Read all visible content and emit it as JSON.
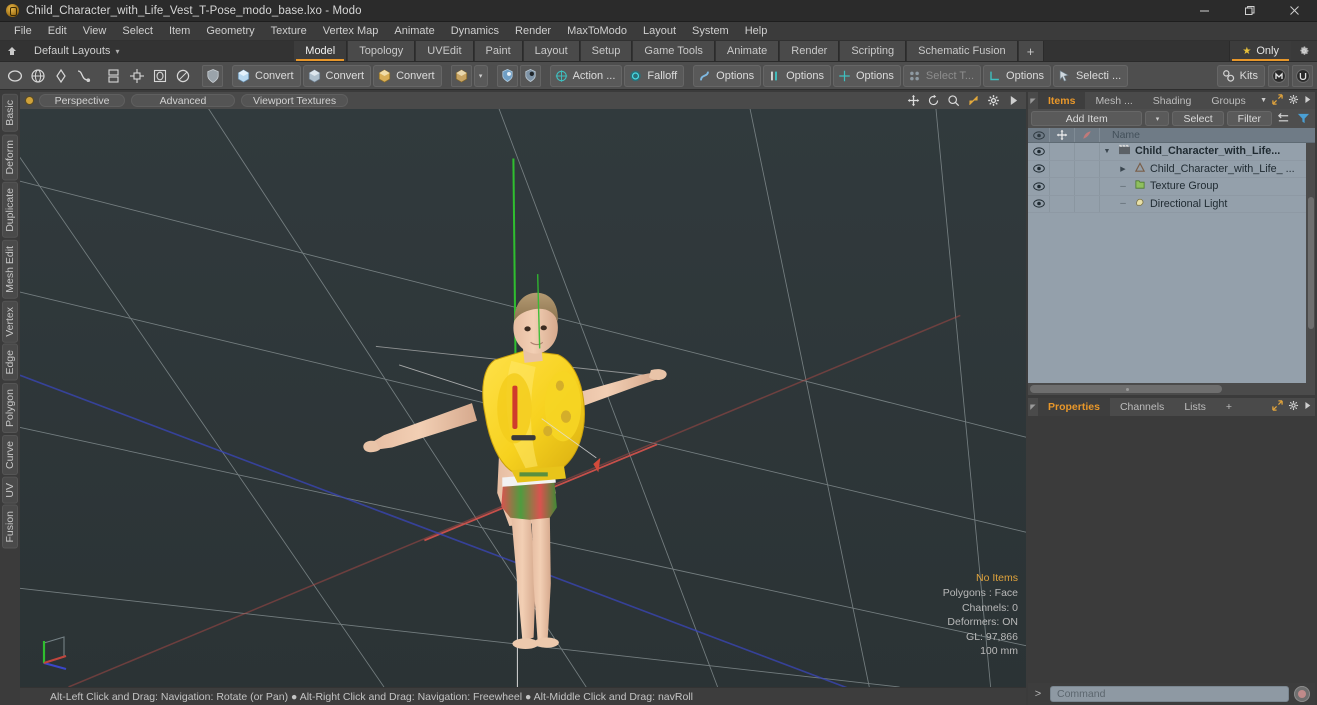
{
  "window": {
    "title": "Child_Character_with_Life_Vest_T-Pose_modo_base.lxo - Modo",
    "app_icon": "modo-icon",
    "minimize": "minimize-icon",
    "maximize": "restore-icon",
    "close": "close-icon"
  },
  "menubar": {
    "items": [
      "File",
      "Edit",
      "View",
      "Select",
      "Item",
      "Geometry",
      "Texture",
      "Vertex Map",
      "Animate",
      "Dynamics",
      "Render",
      "MaxToModo",
      "Layout",
      "System",
      "Help"
    ]
  },
  "layoutbar": {
    "home_icon": "home-icon",
    "default_layouts": "Default Layouts",
    "caret": "▾",
    "tabs": [
      {
        "label": "Model",
        "active": true
      },
      {
        "label": "Topology",
        "active": false
      },
      {
        "label": "UVEdit",
        "active": false
      },
      {
        "label": "Paint",
        "active": false
      },
      {
        "label": "Layout",
        "active": false
      },
      {
        "label": "Setup",
        "active": false
      },
      {
        "label": "Game Tools",
        "active": false
      },
      {
        "label": "Animate",
        "active": false
      },
      {
        "label": "Render",
        "active": false
      },
      {
        "label": "Scripting",
        "active": false
      },
      {
        "label": "Schematic Fusion",
        "active": false
      }
    ],
    "add_tab": "+",
    "only_label": "Only",
    "star_icon": "star-icon",
    "gear_icon": "gear-icon"
  },
  "toolbar": {
    "mode_icons": [
      "ellipse-icon",
      "globe-icon",
      "pen-icon",
      "curve-icon",
      "duplicate-icon",
      "crosshair-icon",
      "square-in-square-icon",
      "circle-slash-icon",
      "shield-icon"
    ],
    "buttons": [
      {
        "label": "Convert",
        "color": "#d9e8f2",
        "dim": false
      },
      {
        "label": "Convert",
        "color": "#cdd8e0",
        "dim": false
      },
      {
        "label": "Convert",
        "color": "#e3c884",
        "dim": false
      }
    ],
    "cube_icon": "cube-icon",
    "cube_caret": "▾",
    "paint_icons": [
      "falloff-blue-icon",
      "falloff-dark-icon"
    ],
    "action_button": {
      "label": "Action  ...",
      "icon": "action-center-icon"
    },
    "falloff_button": {
      "label": "Falloff",
      "icon": "falloff-icon"
    },
    "options_buttons": [
      {
        "label": "Options",
        "icon": "snap-icon"
      },
      {
        "label": "Options",
        "icon": "bars-icon"
      },
      {
        "label": "Options",
        "icon": "crosshair-icon"
      }
    ],
    "select_through": {
      "label": "Select T...",
      "icon": "select-through-icon",
      "dim": true
    },
    "workplane_options": {
      "label": "Options",
      "icon": "workplane-icon"
    },
    "selection_button": {
      "label": "Selecti ...",
      "icon": "selection-icon"
    },
    "kits_button": {
      "label": "Kits",
      "icon": "kits-icon"
    },
    "right_icons": [
      "modo-logo-icon",
      "unreal-logo-icon"
    ]
  },
  "left_tabs": [
    "Basic",
    "Deform",
    "Duplicate",
    "Mesh Edit",
    "Vertex",
    "Edge",
    "Polygon",
    "Curve",
    "UV",
    "Fusion"
  ],
  "viewport": {
    "header": {
      "indicator_icon": "viewport-indicator-icon",
      "pills": [
        "Perspective",
        "Advanced",
        "Viewport Textures"
      ],
      "right_icons": [
        "move-icon",
        "rotate-icon",
        "zoom-icon",
        "fit-icon",
        "gear-icon",
        "play-icon"
      ]
    },
    "stats": {
      "no_items": "No Items",
      "polygons": "Polygons : Face",
      "channels": "Channels: 0",
      "deformers": "Deformers: ON",
      "gl": "GL: 97,866",
      "scale": "100 mm"
    },
    "scene": {
      "subject": "child character with yellow life vest in T-pose",
      "background_color": "#2e3639",
      "grid_line_color": "#9aa4a6",
      "axis_x_color": "#b34b4b",
      "axis_y_color": "#3ec13e",
      "axis_z_color": "#3b48c8"
    },
    "gizmo": "axis-gizmo"
  },
  "statusbar": {
    "text": "Alt-Left Click and Drag: Navigation: Rotate (or Pan) ● Alt-Right Click and Drag: Navigation: Freewheel ● Alt-Middle Click and Drag: navRoll"
  },
  "right_panel": {
    "tabs": [
      {
        "label": "Items",
        "active": true
      },
      {
        "label": "Mesh ...",
        "active": false
      },
      {
        "label": "Shading",
        "active": false
      },
      {
        "label": "Groups",
        "active": false
      }
    ],
    "tab_right_icons": [
      "chevron-down-icon",
      "expand-icon",
      "gear-icon",
      "play-icon"
    ],
    "toolrow": {
      "add_item": "Add Item",
      "add_item_caret": "▾",
      "select": "Select",
      "filter": "Filter",
      "icons": [
        "swap-icon",
        "filter-funnel-icon"
      ]
    },
    "item_list": {
      "columns": {
        "eye": "eye-icon",
        "move": "move-icon",
        "render": "render-icon",
        "name": "Name"
      },
      "rows": [
        {
          "eye": "eye-icon",
          "twisty": "▼",
          "icon": "scene-icon",
          "label": "Child_Character_with_Life...",
          "bold": true,
          "indent": 0
        },
        {
          "eye": "eye-icon",
          "twisty": "▶",
          "icon": "mesh-icon",
          "label": "Child_Character_with_Life_ ...",
          "bold": false,
          "indent": 1
        },
        {
          "eye": "eye-icon",
          "twisty": "–",
          "icon": "texture-group-icon",
          "label": "Texture Group",
          "bold": false,
          "indent": 1
        },
        {
          "eye": "eye-icon",
          "twisty": "–",
          "icon": "light-icon",
          "label": "Directional Light",
          "bold": false,
          "indent": 1
        }
      ]
    },
    "property_tabs": [
      {
        "label": "Properties",
        "active": true
      },
      {
        "label": "Channels",
        "active": false
      },
      {
        "label": "Lists",
        "active": false
      },
      {
        "label": "+",
        "active": false
      }
    ],
    "property_tab_right_icons": [
      "expand-icon",
      "gear-icon",
      "play-icon"
    ]
  },
  "command_bar": {
    "prompt": ">",
    "placeholder": "Command",
    "record_icon": "record-icon"
  }
}
